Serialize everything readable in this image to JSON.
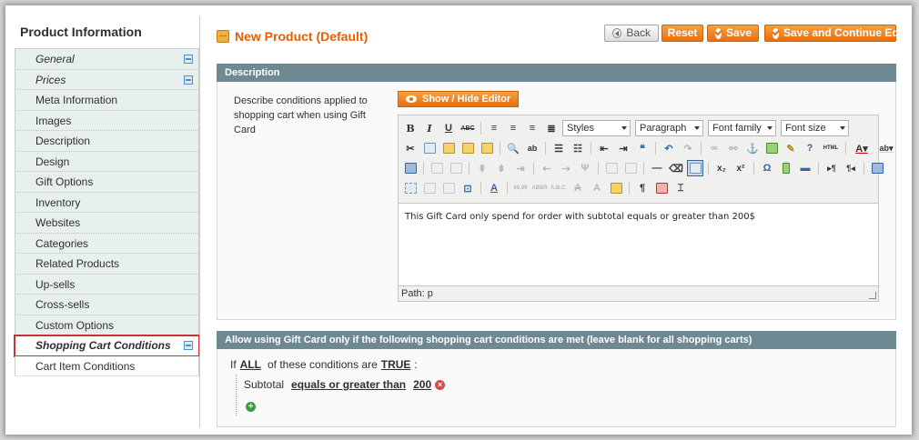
{
  "sidebar": {
    "title": "Product Information",
    "items": [
      {
        "label": "General"
      },
      {
        "label": "Prices"
      },
      {
        "label": "Meta Information"
      },
      {
        "label": "Images"
      },
      {
        "label": "Description"
      },
      {
        "label": "Design"
      },
      {
        "label": "Gift Options"
      },
      {
        "label": "Inventory"
      },
      {
        "label": "Websites"
      },
      {
        "label": "Categories"
      },
      {
        "label": "Related Products"
      },
      {
        "label": "Up-sells"
      },
      {
        "label": "Cross-sells"
      },
      {
        "label": "Custom Options"
      },
      {
        "label": "Shopping Cart Conditions"
      },
      {
        "label": "Cart Item Conditions"
      }
    ]
  },
  "header": {
    "title": "New Product (Default)",
    "back_label": "Back",
    "reset_label": "Reset",
    "save_label": "Save",
    "save_continue_label": "Save and Continue Edit"
  },
  "description": {
    "section_title": "Description",
    "field_label": "Describe conditions applied to shopping cart when using Gift Card",
    "show_hide_label": "Show / Hide Editor",
    "styles": "Styles",
    "paragraph": "Paragraph",
    "font_family": "Font family",
    "font_size": "Font size",
    "content": "This Gift Card only spend for order with subtotal equals or greater than 200$",
    "path": "Path: p"
  },
  "conditions": {
    "section_title": "Allow using Gift Card only if the following shopping cart conditions are met (leave blank for all shopping carts)",
    "if_prefix": "If",
    "aggregator": "ALL",
    "middle_text": "of these conditions are",
    "value": "TRUE",
    "suffix": ":",
    "rule_attribute": "Subtotal",
    "rule_operator": "equals or greater than",
    "rule_value": "200"
  }
}
